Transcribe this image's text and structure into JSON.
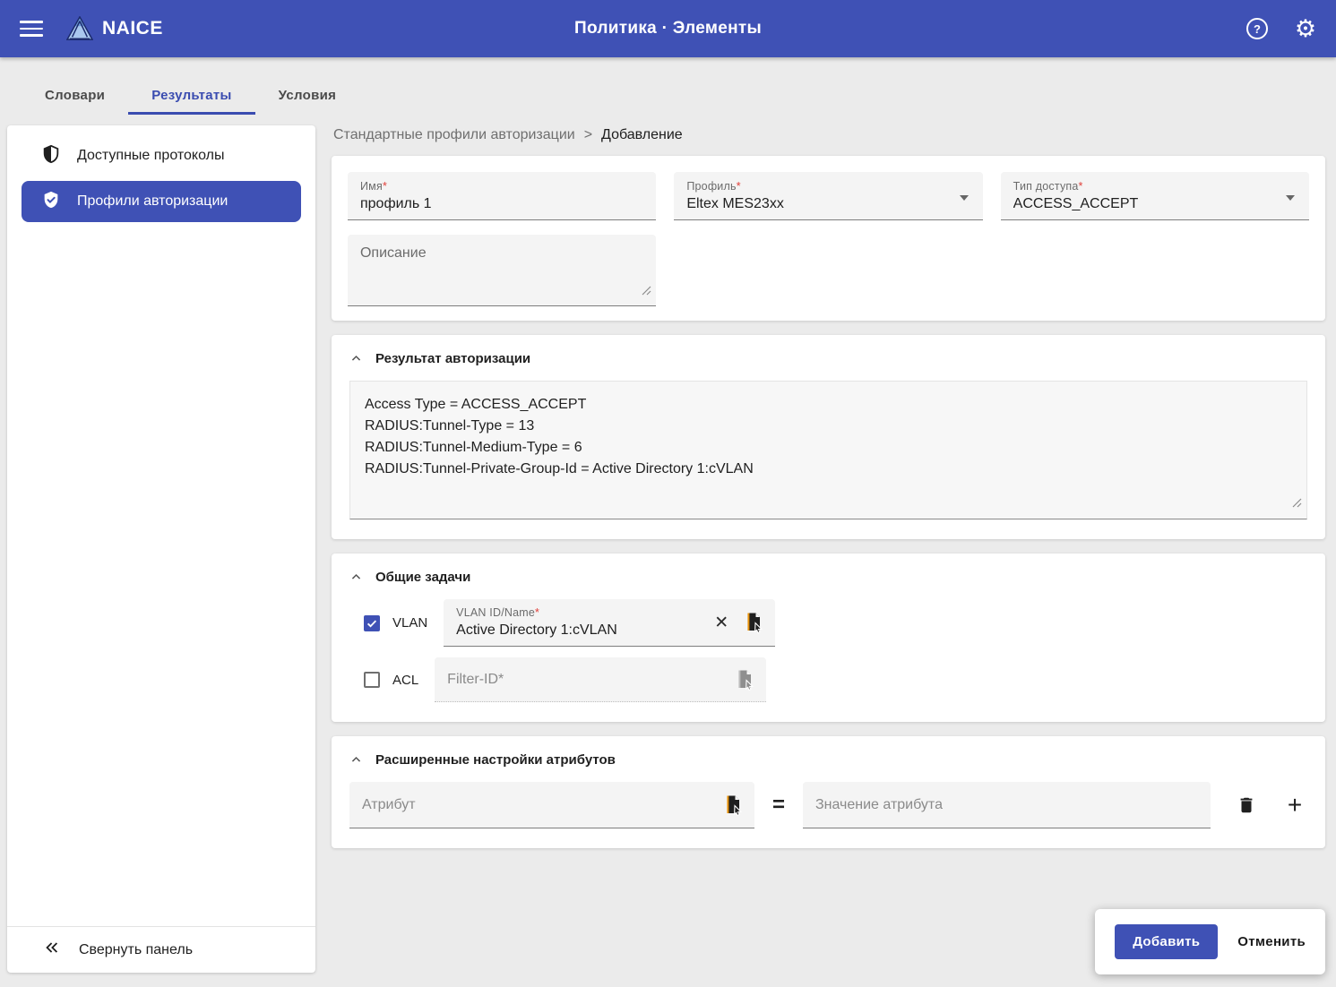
{
  "header": {
    "app_name": "NAICE",
    "title": "Политика · Элементы"
  },
  "tabs": [
    {
      "label": "Словари",
      "active": false
    },
    {
      "label": "Результаты",
      "active": true
    },
    {
      "label": "Условия",
      "active": false
    }
  ],
  "sidebar": {
    "items": [
      {
        "label": "Доступные протоколы",
        "selected": false
      },
      {
        "label": "Профили авторизации",
        "selected": true
      }
    ],
    "collapse_label": "Свернуть панель"
  },
  "breadcrumb": {
    "parent": "Стандартные профили авторизации",
    "separator": ">",
    "current": "Добавление"
  },
  "required_mark": "*",
  "form": {
    "name": {
      "label": "Имя",
      "value": "профиль 1"
    },
    "profile": {
      "label": "Профиль",
      "value": "Eltex MES23xx"
    },
    "access_type": {
      "label": "Тип доступа",
      "value": "ACCESS_ACCEPT"
    },
    "description": {
      "label": "Описание",
      "value": ""
    }
  },
  "authorization_result": {
    "title": "Результат авторизации",
    "content": "Access Type = ACCESS_ACCEPT\nRADIUS:Tunnel-Type = 13\nRADIUS:Tunnel-Medium-Type = 6\nRADIUS:Tunnel-Private-Group-Id = Active Directory 1:cVLAN"
  },
  "common_tasks": {
    "title": "Общие задачи",
    "vlan": {
      "checkbox_label": "VLAN",
      "checked": true,
      "field_label": "VLAN ID/Name",
      "value": "Active Directory 1:cVLAN",
      "clear_glyph": "✕"
    },
    "acl": {
      "checkbox_label": "ACL",
      "checked": false,
      "placeholder": "Filter-ID*"
    }
  },
  "advanced_attributes": {
    "title": "Расширенные настройки атрибутов",
    "attribute_placeholder": "Атрибут",
    "equals_sign": "=",
    "value_placeholder": "Значение атрибута",
    "plus_glyph": "+"
  },
  "actions": {
    "submit": "Добавить",
    "cancel": "Отменить"
  },
  "icons": {
    "gear_glyph": "⚙",
    "help_glyph": "?"
  },
  "colors": {
    "primary": "#3f51b5",
    "accent_orange": "#e8930c",
    "required_red": "#e0403a",
    "page_background": "#ebebeb"
  }
}
